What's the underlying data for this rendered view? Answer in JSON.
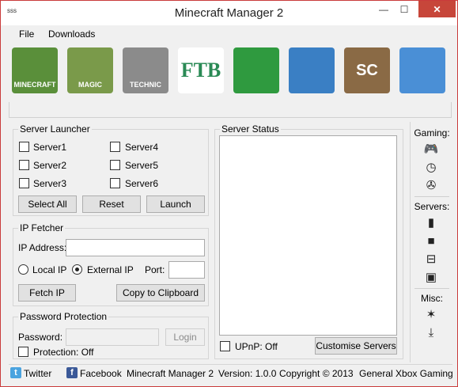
{
  "window": {
    "title": "Minecraft Manager 2",
    "title_icon": "sss",
    "minimize": "—",
    "maximize": "☐",
    "close": "✕"
  },
  "menu": {
    "file": "File",
    "downloads": "Downloads"
  },
  "toolbar": [
    {
      "name": "minecraft",
      "label": "MINECRAFT",
      "color": "#5a8f3a"
    },
    {
      "name": "magic",
      "label": "MAGIC",
      "color": "#7a9a4a"
    },
    {
      "name": "technic",
      "label": "TECHNIC",
      "color": "#8b8b8b"
    },
    {
      "name": "ftb",
      "label": "FTB",
      "color": "#2a8a55"
    },
    {
      "name": "cube-pencil",
      "label": "",
      "color": "#2f9a3f"
    },
    {
      "name": "blueprint",
      "label": "",
      "color": "#3a7fc4"
    },
    {
      "name": "sc",
      "label": "SC",
      "color": "#8a6a45"
    },
    {
      "name": "folder",
      "label": "",
      "color": "#4a8fd6"
    }
  ],
  "server_launcher": {
    "title": "Server Launcher",
    "servers": [
      "Server1",
      "Server2",
      "Server3",
      "Server4",
      "Server5",
      "Server6"
    ],
    "select_all": "Select All",
    "reset": "Reset",
    "launch": "Launch"
  },
  "ip_fetcher": {
    "title": "IP Fetcher",
    "ip_label": "IP Address:",
    "ip_value": "",
    "local_ip": "Local IP",
    "external_ip": "External IP",
    "port_label": "Port:",
    "port_value": "",
    "fetch_ip": "Fetch IP",
    "copy": "Copy to Clipboard"
  },
  "password_protection": {
    "title": "Password Protection",
    "password_label": "Password:",
    "login": "Login",
    "protection": "Protection: Off"
  },
  "server_status": {
    "title": "Server Status",
    "upnp": "UPnP: Off",
    "customise": "Customise Servers"
  },
  "sidebar": {
    "gaming": "Gaming:",
    "servers": "Servers:",
    "misc": "Misc:",
    "gaming_icons": [
      "gamepad-icon",
      "clock-icon",
      "film-reel-icon"
    ],
    "server_icons": [
      "server-tower-icon",
      "briefcase-icon",
      "network-icon",
      "window-icon"
    ],
    "misc_icons": [
      "magic-wand-icon",
      "download-icon"
    ]
  },
  "statusbar": {
    "twitter": "Twitter",
    "facebook": "Facebook",
    "app": "Minecraft Manager 2",
    "version": "Version: 1.0.0",
    "copyright": "Copyright © 2013",
    "author": "General Xbox Gaming"
  }
}
